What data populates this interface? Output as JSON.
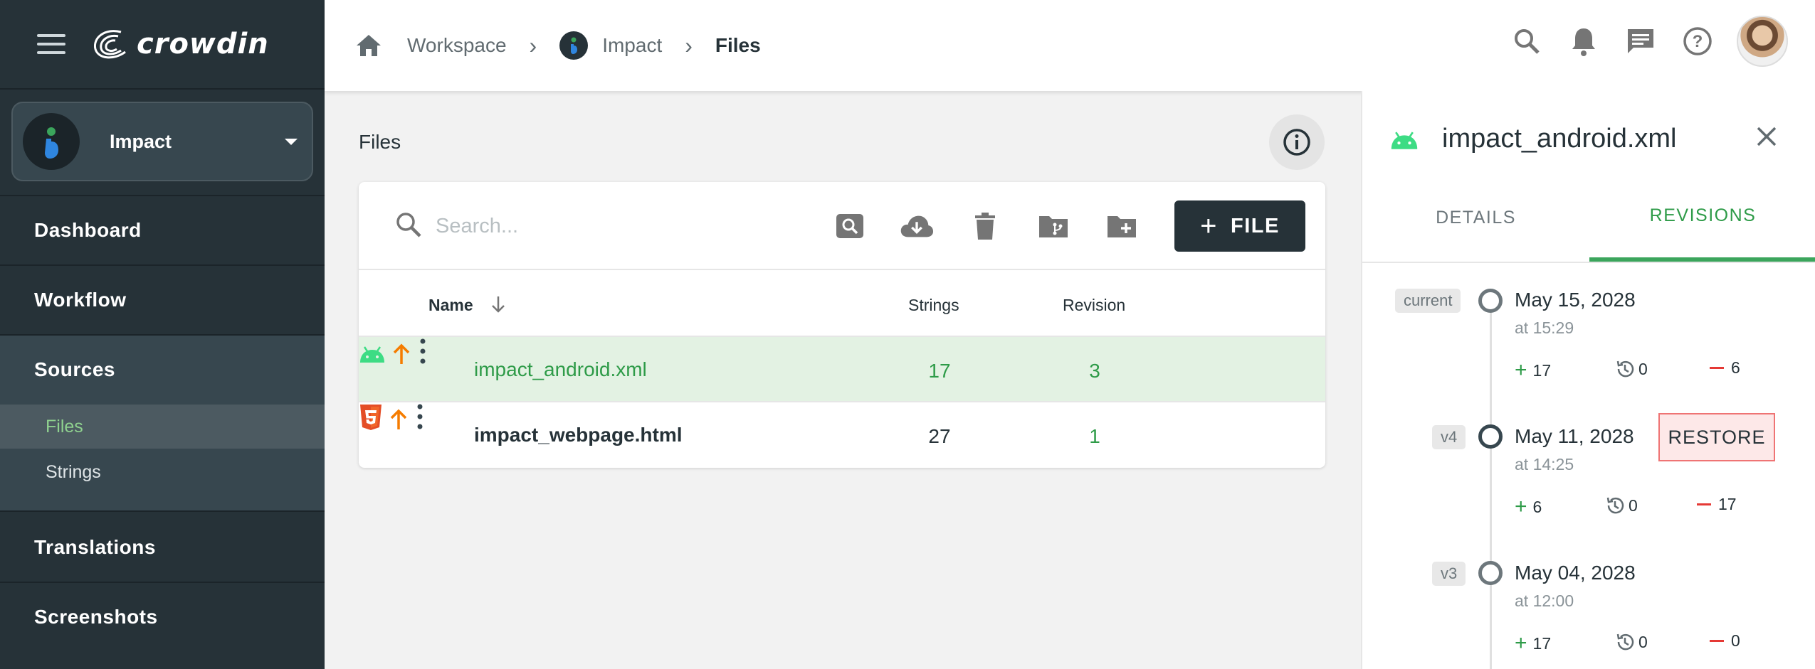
{
  "app": {
    "logo_text": "crowdin"
  },
  "project": {
    "name": "Impact"
  },
  "sidebar": {
    "items": [
      {
        "label": "Dashboard"
      },
      {
        "label": "Workflow"
      },
      {
        "label": "Sources"
      },
      {
        "label": "Translations"
      },
      {
        "label": "Screenshots"
      }
    ],
    "sub_items": [
      {
        "label": "Files",
        "active": true
      },
      {
        "label": "Strings",
        "active": false
      }
    ]
  },
  "breadcrumb": {
    "items": [
      "Workspace",
      "Impact"
    ],
    "current": "Files"
  },
  "main": {
    "title": "Files",
    "search_placeholder": "Search...",
    "add_file_label": "FILE",
    "columns": {
      "name": "Name",
      "strings": "Strings",
      "revision": "Revision"
    },
    "files": [
      {
        "name": "impact_android.xml",
        "strings": "17",
        "revision": "3",
        "type": "android",
        "selected": true
      },
      {
        "name": "impact_webpage.html",
        "strings": "27",
        "revision": "1",
        "type": "html5",
        "selected": false
      }
    ]
  },
  "panel": {
    "title": "impact_android.xml",
    "tabs": [
      {
        "label": "DETAILS",
        "active": false
      },
      {
        "label": "REVISIONS",
        "active": true
      }
    ],
    "revisions": [
      {
        "tag": "current",
        "date": "May 15, 2028",
        "time": "at 15:29",
        "added": "17",
        "restored": "0",
        "removed": "6",
        "restore": false
      },
      {
        "tag": "v4",
        "date": "May 11, 2028",
        "time": "at 14:25",
        "added": "6",
        "restored": "0",
        "removed": "17",
        "restore": true,
        "restore_label": "RESTORE"
      },
      {
        "tag": "v3",
        "date": "May 04, 2028",
        "time": "at 12:00",
        "added": "17",
        "restored": "0",
        "removed": "0",
        "restore": false
      }
    ]
  },
  "colors": {
    "sidebar_bg": "#263238",
    "accent_green": "#2e9b48",
    "highlight_row": "#e3f2e3",
    "upload_orange": "#f57c00",
    "removed_red": "#e53935",
    "restore_border": "#ef7474"
  }
}
